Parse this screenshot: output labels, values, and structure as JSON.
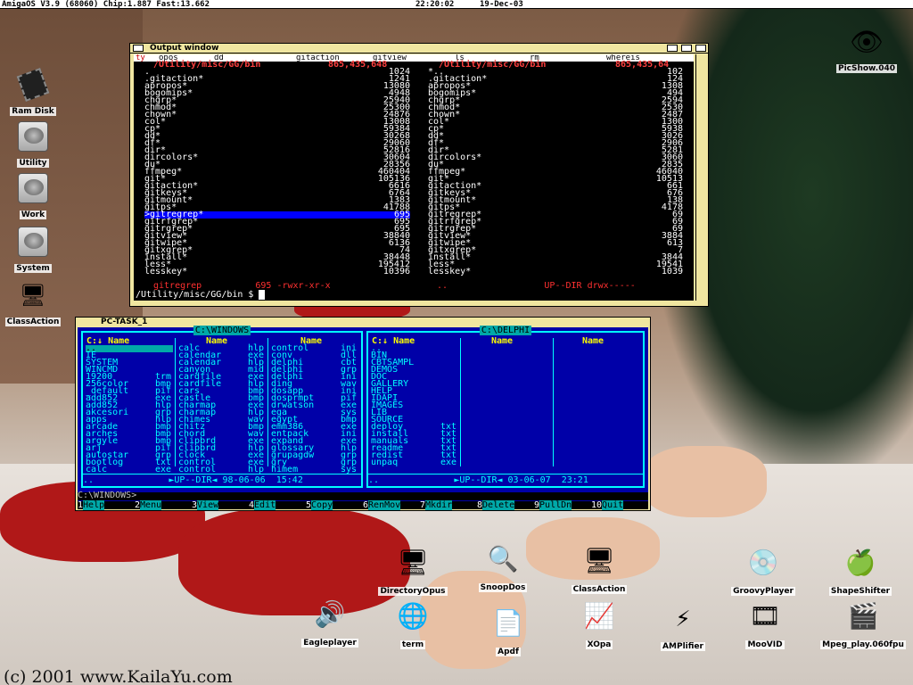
{
  "screen": {
    "title": "AmigaOS V3.9 (68060) Chip:1.887 Fast:13.662",
    "time": "22:20:02",
    "date": "19-Dec-03"
  },
  "desktop_icons": [
    {
      "label": "Ram Disk",
      "icon": "chip-icon"
    },
    {
      "label": "Utility",
      "icon": "harddisk-icon"
    },
    {
      "label": "Work",
      "icon": "harddisk-icon"
    },
    {
      "label": "System",
      "icon": "harddisk-icon"
    },
    {
      "label": "ClassAction",
      "icon": "monitor-icon"
    }
  ],
  "picshow_label": "PicShow.040",
  "output_window": {
    "title": "Output window",
    "menu": [
      "ty",
      "opos",
      "dd",
      "gitaction",
      "gitview",
      "ls",
      "rm",
      "whereis"
    ],
    "left_header": "/Utility/misc/GG/bin",
    "left_header_size": "865,435,648",
    "right_header": "/Utility/misc/GG/bin",
    "right_header_size": "865,435,64",
    "left_rows": [
      [
        ".",
        "1024"
      ],
      [
        ".gitaction*",
        "1241"
      ],
      [
        "apropos*",
        "13080"
      ],
      [
        "bogomips*",
        "4948"
      ],
      [
        "chgrp*",
        "25940"
      ],
      [
        "chmod*",
        "25300"
      ],
      [
        "chown*",
        "24876"
      ],
      [
        "col*",
        "13008"
      ],
      [
        "cp*",
        "59384"
      ],
      [
        "dd*",
        "30268"
      ],
      [
        "df*",
        "29060"
      ],
      [
        "dir*",
        "52816"
      ],
      [
        "dircolors*",
        "30604"
      ],
      [
        "du*",
        "28356"
      ],
      [
        "ffmpeg*",
        "460404"
      ],
      [
        "git*",
        "105136"
      ],
      [
        "gitaction*",
        "6616"
      ],
      [
        "gitkeys*",
        "6764"
      ],
      [
        "gitmount*",
        "1383"
      ],
      [
        "gitps*",
        "41788"
      ],
      [
        ">gitregrep*",
        "695"
      ],
      [
        "gitrfgrep*",
        "695"
      ],
      [
        "gitrgrep*",
        "695"
      ],
      [
        "gitview*",
        "38840"
      ],
      [
        "gitwipe*",
        "6136"
      ],
      [
        "gitxgrep*",
        "74"
      ],
      [
        "install*",
        "38448"
      ],
      [
        "less*",
        "195412"
      ],
      [
        "lesskey*",
        "10396"
      ]
    ],
    "right_rows": [
      [
        "*..",
        "102"
      ],
      [
        ".gitaction*",
        "124"
      ],
      [
        "apropos*",
        "1308"
      ],
      [
        "bogomips*",
        "494"
      ],
      [
        "chgrp*",
        "2594"
      ],
      [
        "chmod*",
        "2530"
      ],
      [
        "chown*",
        "2487"
      ],
      [
        "col*",
        "1300"
      ],
      [
        "cp*",
        "5938"
      ],
      [
        "dd*",
        "3026"
      ],
      [
        "df*",
        "2906"
      ],
      [
        "dir*",
        "5281"
      ],
      [
        "dircolors*",
        "3060"
      ],
      [
        "du*",
        "2835"
      ],
      [
        "ffmpeg*",
        "46040"
      ],
      [
        "git*",
        "10513"
      ],
      [
        "gitaction*",
        "661"
      ],
      [
        "gitkeys*",
        "676"
      ],
      [
        "gitmount*",
        "138"
      ],
      [
        "gitps*",
        "4178"
      ],
      [
        "gitregrep*",
        "69"
      ],
      [
        "gitrfgrep*",
        "69"
      ],
      [
        "gitrgrep*",
        "69"
      ],
      [
        "gitview*",
        "3884"
      ],
      [
        "gitwipe*",
        "613"
      ],
      [
        "gitxgrep*",
        "7"
      ],
      [
        "install*",
        "3844"
      ],
      [
        "less*",
        "19541"
      ],
      [
        "lesskey*",
        "1039"
      ]
    ],
    "left_status": "gitregrep          695 -rwxr-xr-x",
    "right_status": "..                  UP--DIR drwx-----",
    "prompt": "/Utility/misc/GG/bin $ "
  },
  "pctask": {
    "title": "PC-TASK_1",
    "left_panel_title": "C:\\WINDOWS",
    "right_panel_title": "C:\\DELPHI",
    "name_header": "Name",
    "left_col1_header": "C:↓ Name",
    "left_col1": [
      [
        "..",
        ""
      ],
      [
        "IE",
        ""
      ],
      [
        "SYSTEM",
        ""
      ],
      [
        "WINCMD",
        ""
      ],
      [
        "19200",
        "trm"
      ],
      [
        "256color",
        "bmp"
      ],
      [
        "_default",
        "pif"
      ],
      [
        "add852",
        "exe"
      ],
      [
        "add852",
        "hlp"
      ],
      [
        "akcesori",
        "grp"
      ],
      [
        "apps",
        "hlp"
      ],
      [
        "arcade",
        "bmp"
      ],
      [
        "arches",
        "bmp"
      ],
      [
        "argyle",
        "bmp"
      ],
      [
        "arj",
        "pif"
      ],
      [
        "autostar",
        "grp"
      ],
      [
        "bootlog",
        "txt"
      ],
      [
        "calc",
        "exe"
      ]
    ],
    "left_col2": [
      [
        "calc",
        "hlp"
      ],
      [
        "calendar",
        "exe"
      ],
      [
        "calendar",
        "hlp"
      ],
      [
        "canyon",
        "mid"
      ],
      [
        "cardfile",
        "exe"
      ],
      [
        "cardfile",
        "hlp"
      ],
      [
        "cars",
        "bmp"
      ],
      [
        "castle",
        "bmp"
      ],
      [
        "charmap",
        "exe"
      ],
      [
        "charmap",
        "hlp"
      ],
      [
        "chimes",
        "wav"
      ],
      [
        "chitz",
        "bmp"
      ],
      [
        "chord",
        "wav"
      ],
      [
        "clipbrd",
        "exe"
      ],
      [
        "clipbrd",
        "hlp"
      ],
      [
        "clock",
        "exe"
      ],
      [
        "control",
        "exe"
      ],
      [
        "control",
        "hlp"
      ]
    ],
    "left_col3": [
      [
        "control",
        "ini"
      ],
      [
        "conv",
        "dll"
      ],
      [
        "delphi",
        "cbt"
      ],
      [
        "delphi",
        "grp"
      ],
      [
        "delphi",
        "ini"
      ],
      [
        "ding",
        "wav"
      ],
      [
        "dosapp",
        "ini"
      ],
      [
        "dosprmpt",
        "pif"
      ],
      [
        "drwatson",
        "exe"
      ],
      [
        "ega",
        "sys"
      ],
      [
        "egypt",
        "bmp"
      ],
      [
        "emm386",
        "exe"
      ],
      [
        "entpack",
        "ini"
      ],
      [
        "expand",
        "exe"
      ],
      [
        "glossary",
        "hlp"
      ],
      [
        "grupagdw",
        "grp"
      ],
      [
        "gry",
        "grp"
      ],
      [
        "himem",
        "sys"
      ]
    ],
    "right_col1_header": "C:↓ Name",
    "right_col1": [
      [
        "..",
        ""
      ],
      [
        "BIN",
        ""
      ],
      [
        "CBTSAMPL",
        ""
      ],
      [
        "DEMOS",
        ""
      ],
      [
        "DOC",
        ""
      ],
      [
        "GALLERY",
        ""
      ],
      [
        "HELP",
        ""
      ],
      [
        "IDAPI",
        ""
      ],
      [
        "IMAGES",
        ""
      ],
      [
        "LIB",
        ""
      ],
      [
        "SOURCE",
        ""
      ],
      [
        "deploy",
        "txt"
      ],
      [
        "install",
        "txt"
      ],
      [
        "manuals",
        "txt"
      ],
      [
        "readme",
        "txt"
      ],
      [
        "redist",
        "txt"
      ],
      [
        "unpaq",
        "exe"
      ]
    ],
    "left_status": "..              ►UP--DIR◄ 98-06-06  15:42",
    "right_status": "..              ►UP--DIR◄ 03-06-07  23:21",
    "cmdline": "C:\\WINDOWS>",
    "keys": [
      {
        "n": "1",
        "label": "Help"
      },
      {
        "n": "2",
        "label": "Menu"
      },
      {
        "n": "3",
        "label": "View"
      },
      {
        "n": "4",
        "label": "Edit"
      },
      {
        "n": "5",
        "label": "Copy"
      },
      {
        "n": "6",
        "label": "RenMov"
      },
      {
        "n": "7",
        "label": "Mkdir"
      },
      {
        "n": "8",
        "label": "Delete"
      },
      {
        "n": "9",
        "label": "PullDn"
      },
      {
        "n": "10",
        "label": "Quit"
      }
    ]
  },
  "bottom_icons": [
    {
      "label": "DirectoryOpus",
      "icon": "monitor-icon"
    },
    {
      "label": "SnoopDos",
      "icon": "magnifier-icon"
    },
    {
      "label": "ClassAction",
      "icon": "monitor-icon"
    },
    {
      "label": "GroovyPlayer",
      "icon": "cd-icon"
    },
    {
      "label": "ShapeShifter",
      "icon": "apple-icon"
    },
    {
      "label": "Eagleplayer",
      "icon": "speaker-icon"
    },
    {
      "label": "term",
      "icon": "globe-icon"
    },
    {
      "label": "Apdf",
      "icon": "pdf-icon"
    },
    {
      "label": "XOpa",
      "icon": "oscilloscope-icon"
    },
    {
      "label": "AMPlifier",
      "icon": "lightning-icon"
    },
    {
      "label": "MooVID",
      "icon": "film-icon"
    },
    {
      "label": "Mpeg_play.060fpu",
      "icon": "clapper-icon"
    }
  ],
  "copyright": "(c) 2001 www.KailaYu.com"
}
